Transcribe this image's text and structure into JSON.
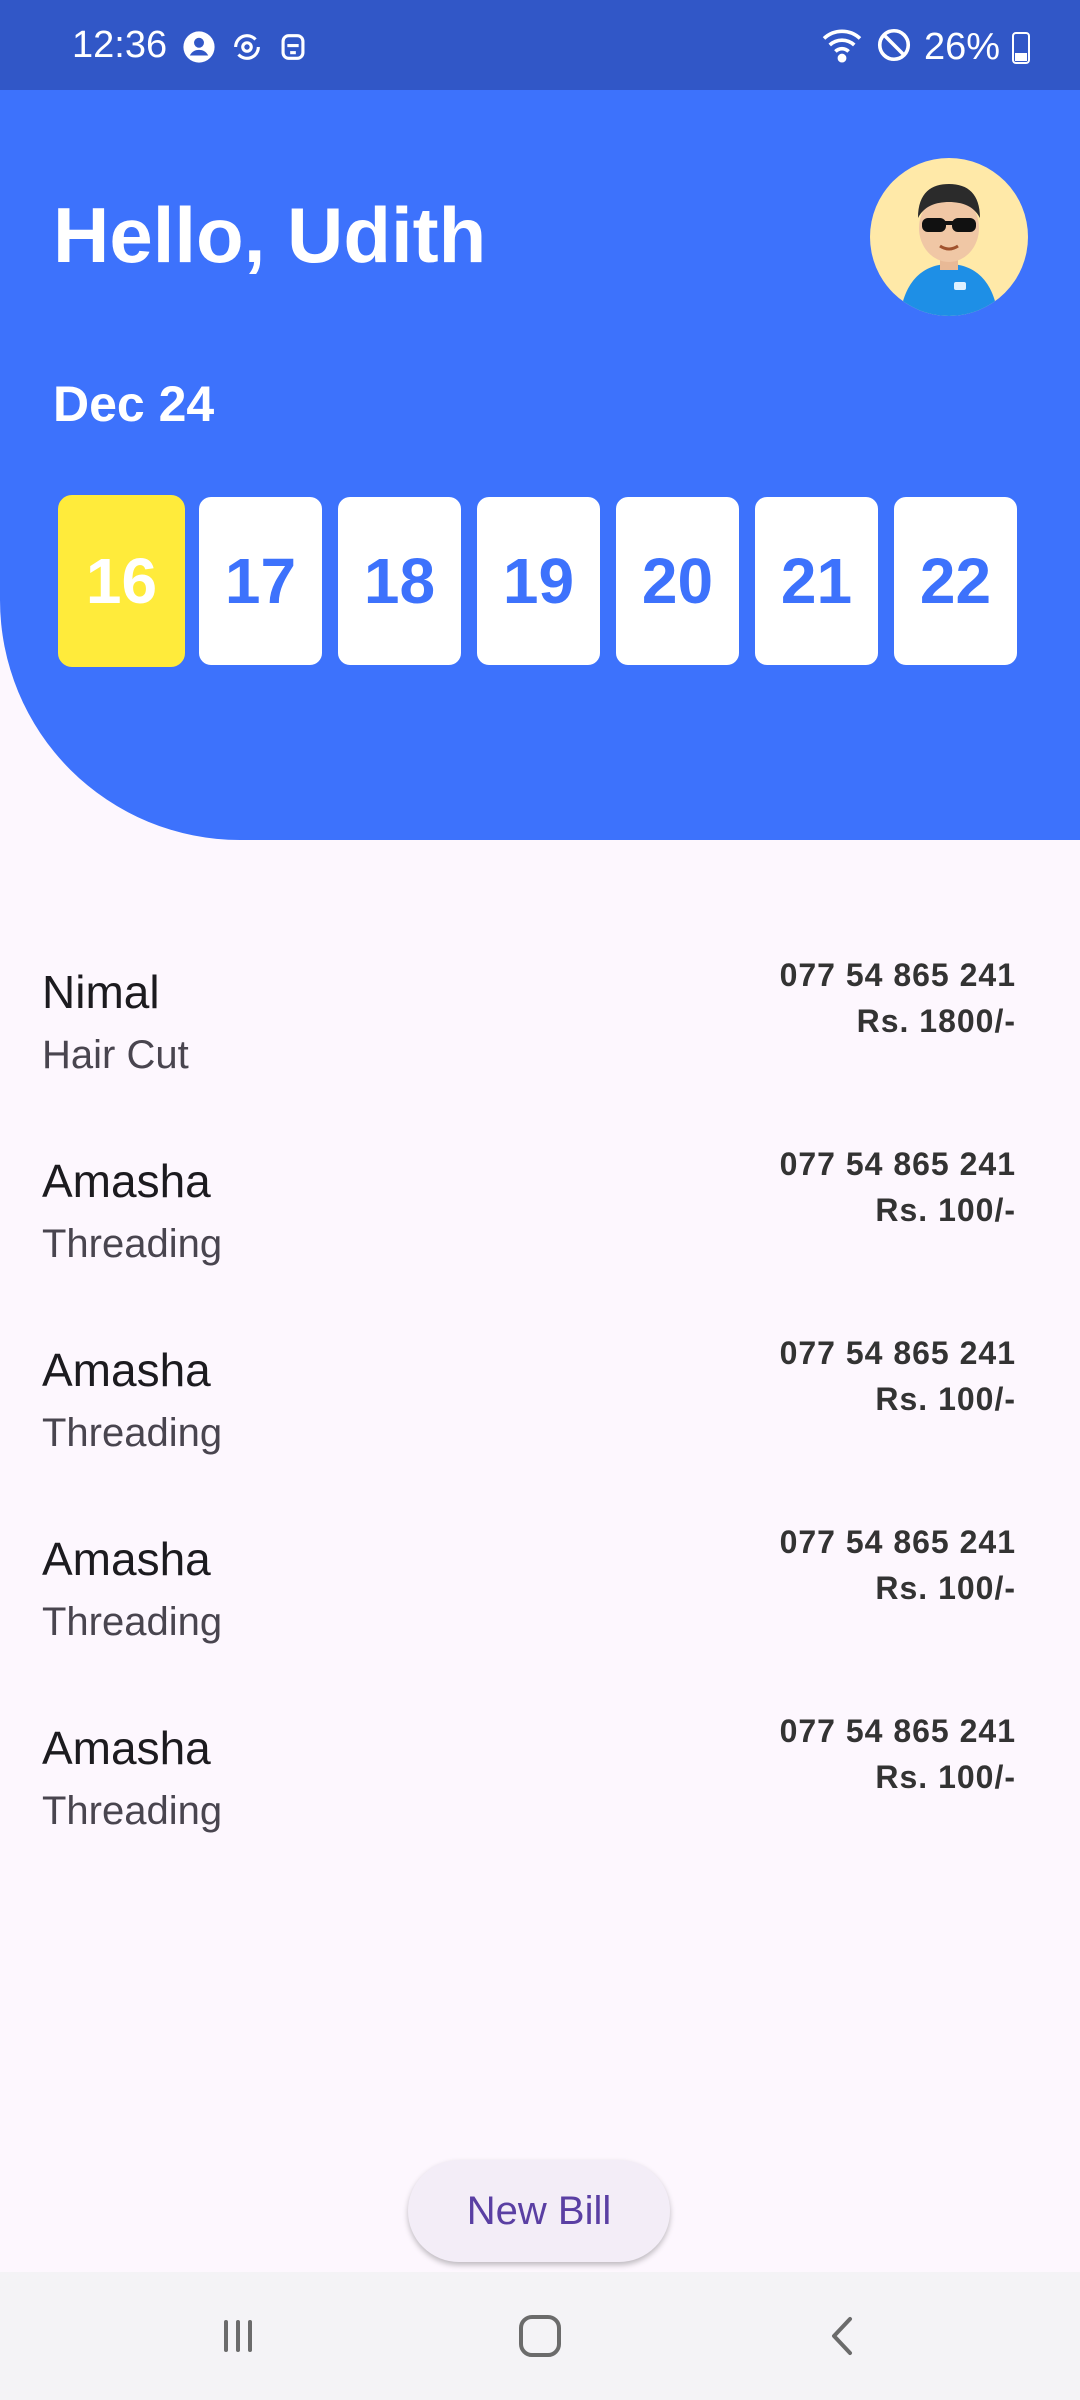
{
  "status_bar": {
    "time": "12:36",
    "battery_percent": "26%",
    "left_icons": [
      "person-circle-icon",
      "sync-icon",
      "robot-icon"
    ],
    "right_icons": [
      "wifi-icon",
      "do-not-disturb-icon",
      "battery-icon"
    ]
  },
  "header": {
    "greeting": "Hello, Udith",
    "month_label": "Dec 24",
    "days": [
      "16",
      "17",
      "18",
      "19",
      "20",
      "21",
      "22"
    ],
    "selected_day": "16",
    "colors": {
      "primary": "#3d72fc",
      "selected": "#ffeb3b"
    }
  },
  "bills": [
    {
      "name": "Nimal",
      "service": "Hair Cut",
      "phone": "077 54 865 241",
      "amount": "Rs. 1800/-"
    },
    {
      "name": "Amasha",
      "service": "Threading",
      "phone": "077 54 865 241",
      "amount": "Rs. 100/-"
    },
    {
      "name": "Amasha",
      "service": "Threading",
      "phone": "077 54 865 241",
      "amount": "Rs. 100/-"
    },
    {
      "name": "Amasha",
      "service": "Threading",
      "phone": "077 54 865 241",
      "amount": "Rs. 100/-"
    },
    {
      "name": "Amasha",
      "service": "Threading",
      "phone": "077 54 865 241",
      "amount": "Rs. 100/-"
    }
  ],
  "actions": {
    "new_bill_label": "New Bill"
  },
  "nav_bar": {
    "icons": [
      "recent-apps-icon",
      "home-icon",
      "back-icon"
    ]
  }
}
